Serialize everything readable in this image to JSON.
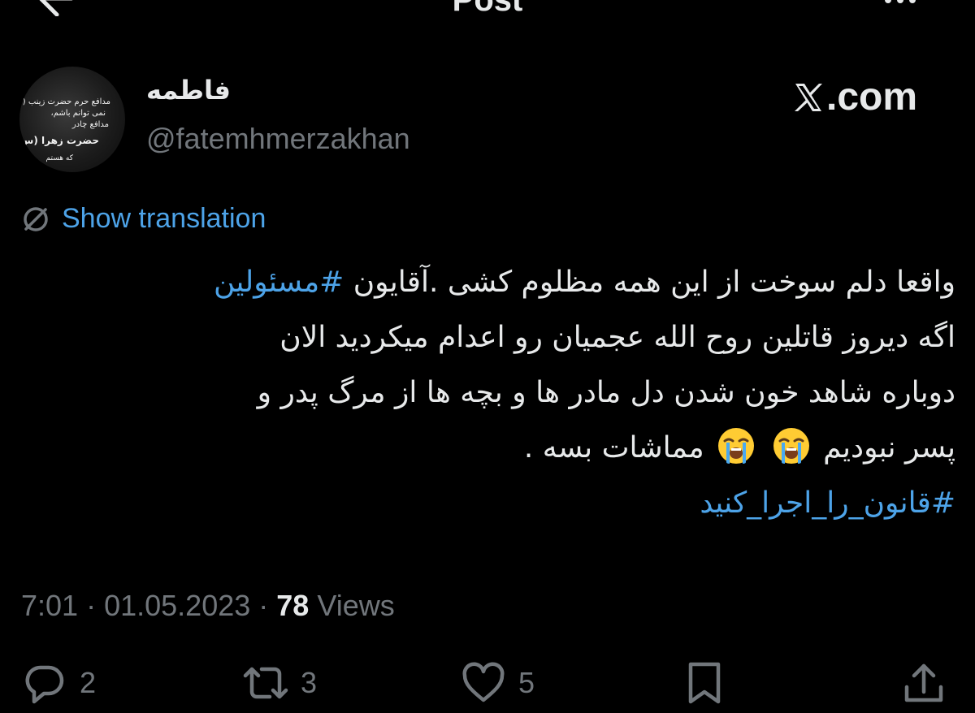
{
  "header": {
    "title": "Post",
    "back_icon": "arrow-left-icon",
    "more_icon": "more-dots-icon"
  },
  "author": {
    "display_name": "فاطمه",
    "handle": "@fatemhmerzakhan",
    "avatar_text": [
      "مدافع حرم حضرت زینب (س)",
      "نمی توانم باشم،",
      "مدافع چادر",
      "حضرت زهرا (س)",
      "که هستم"
    ]
  },
  "source_badge": {
    "text": ".com",
    "logo": "x-logo"
  },
  "translation": {
    "label": "Show translation",
    "icon": "translate-globe-icon"
  },
  "tweet": {
    "line1_text": "واقعا دلم سوخت از این همه مظلوم کشی .آقایون ",
    "line1_hashtag": "#مسئولین",
    "line2": "اگه دیروز قاتلین روح الله عجمیان رو اعدام میکردید الان",
    "line3": "دوباره شاهد خون شدن  دل مادر ها و بچه ها از مرگ پدر و",
    "line4_text": "پسر نبودیم",
    "line4_end": "مماشات بسه .",
    "emoji": "loudly-crying-face",
    "line5_hashtag": "#قانون_را_اجرا_کنید"
  },
  "meta": {
    "time": "7:01",
    "separator": " · ",
    "date": "01.05.2023",
    "views_count": "78",
    "views_label": "Views"
  },
  "actions": {
    "reply_count": "2",
    "repost_count": "3",
    "like_count": "5",
    "reply_icon": "reply-bubble-icon",
    "repost_icon": "repost-arrows-icon",
    "like_icon": "heart-icon",
    "bookmark_icon": "bookmark-icon",
    "share_icon": "share-upload-icon"
  },
  "colors": {
    "background": "#000000",
    "text_primary": "#e7e9ea",
    "text_secondary": "#71767b",
    "link": "#4da3e8"
  }
}
